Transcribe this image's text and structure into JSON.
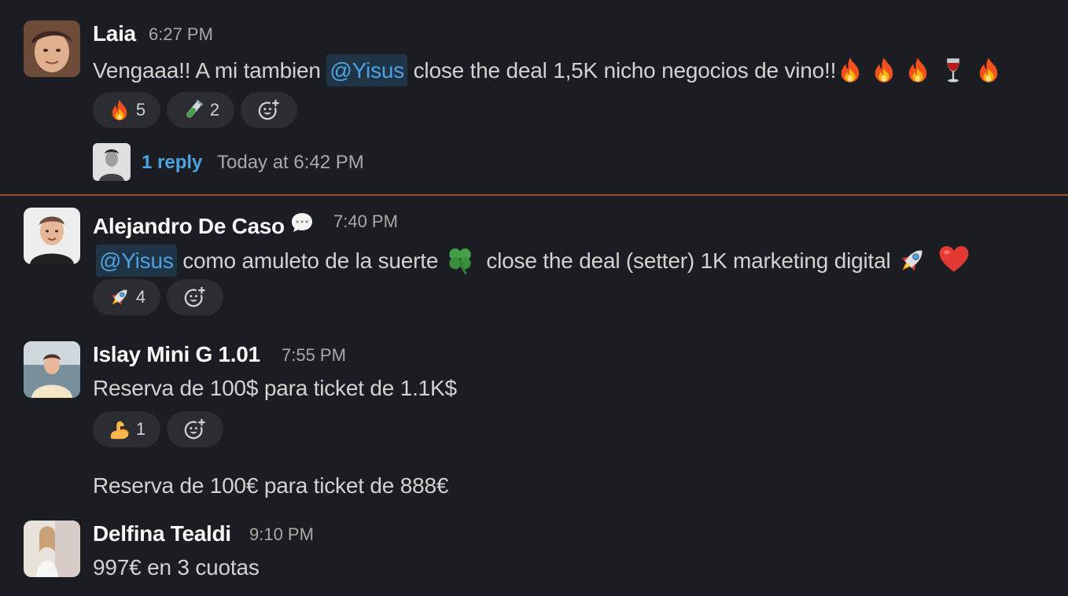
{
  "messages": [
    {
      "author": "Laia",
      "time": "6:27 PM",
      "text_pre": "Vengaaa!! A mi tambien ",
      "mention": "@Yisus",
      "text_post": " close the deal 1,5K nicho negocios de vino!!",
      "trailing_emojis": [
        "fire-emoji",
        "fire-emoji",
        "fire-emoji",
        "wine-glass-emoji",
        "fire-emoji"
      ],
      "reactions": [
        {
          "emoji": "fire-emoji",
          "count": "5"
        },
        {
          "emoji": "test-tube-emoji",
          "count": "2"
        }
      ],
      "thread": {
        "reply_label": "1 reply",
        "reply_time": "Today at 6:42 PM"
      }
    },
    {
      "author": "Alejandro De Caso",
      "status_icon": "speech-bubble-icon",
      "time": "7:40 PM",
      "mention": "@Yisus",
      "text_a": " como amuleto de la suerte ",
      "text_b": " close the deal (setter) 1K marketing digital ",
      "inline_emojis": [
        "four-leaf-clover-emoji",
        "rocket-emoji",
        "red-heart-emoji"
      ],
      "reactions": [
        {
          "emoji": "rocket-emoji",
          "count": "4"
        }
      ]
    },
    {
      "author": "Islay Mini G 1.01",
      "time": "7:55 PM",
      "text": "Reserva de 100$ para ticket de 1.1K$",
      "reactions": [
        {
          "emoji": "flexed-biceps-emoji",
          "count": "1"
        }
      ]
    },
    {
      "continuation_text": "Reserva de 100€ para ticket de 888€"
    },
    {
      "author": "Delfina Tealdi",
      "time": "9:10 PM",
      "text": "997€ en 3 cuotas"
    }
  ],
  "colors": {
    "background": "#1a1d21",
    "mention_bg": "#1f3446",
    "link": "#4da3e0",
    "divider": "#9b4a2e",
    "reaction_bg": "#2a2d31"
  },
  "icons": {
    "add_reaction": "add-reaction-icon"
  }
}
